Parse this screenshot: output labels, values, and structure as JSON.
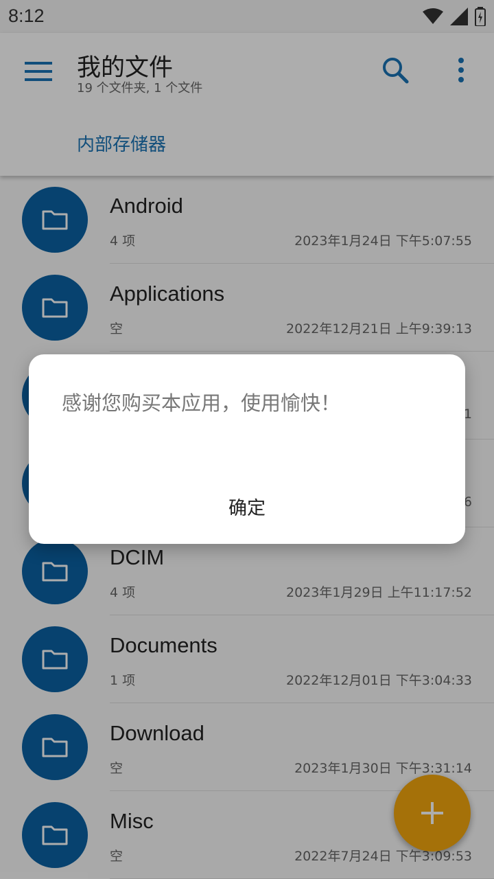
{
  "status_bar": {
    "time": "8:12"
  },
  "app_bar": {
    "title": "我的文件",
    "subtitle": "19 个文件夹, 1 个文件",
    "breadcrumb": "内部存储器"
  },
  "files": [
    {
      "name": "Android",
      "count": "4 项",
      "date": "2023年1月24日 下午5:07:55"
    },
    {
      "name": "Applications",
      "count": "空",
      "date": "2022年12月21日 上午9:39:13"
    },
    {
      "name": "",
      "count": "",
      "date": "1"
    },
    {
      "name": "",
      "count": "",
      "date": "6"
    },
    {
      "name": "DCIM",
      "count": "4 项",
      "date": "2023年1月29日 上午11:17:52"
    },
    {
      "name": "Documents",
      "count": "1 项",
      "date": "2022年12月01日 下午3:04:33"
    },
    {
      "name": "Download",
      "count": "空",
      "date": "2023年1月30日 下午3:31:14"
    },
    {
      "name": "Misc",
      "count": "空",
      "date": "2022年7月24日 下午3:09:53"
    }
  ],
  "dialog": {
    "message": "感谢您购买本应用，使用愉快！",
    "ok_label": "确定"
  },
  "colors": {
    "primary": "#1a73b5",
    "folder": "#0b62a4",
    "fab": "#f3a70e"
  },
  "icons": {
    "menu": "hamburger-menu-icon",
    "search": "search-icon",
    "more": "more-vert-icon",
    "folder": "folder-icon",
    "add": "plus-icon"
  }
}
